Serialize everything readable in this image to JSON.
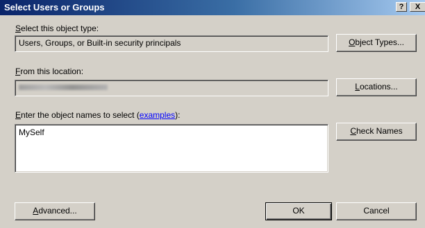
{
  "window": {
    "title": "Select Users or Groups",
    "help_glyph": "?",
    "close_glyph": "X"
  },
  "object_type": {
    "label_key": "S",
    "label_rest": "elect this object type:",
    "value": "Users, Groups, or Built-in security principals",
    "button_key": "O",
    "button_rest": "bject Types..."
  },
  "location": {
    "label_key": "F",
    "label_rest": "rom this location:",
    "value_obscured": true,
    "button_key": "L",
    "button_rest": "ocations..."
  },
  "names": {
    "label_key": "E",
    "label_pre": "nter the object names to select (",
    "label_link": "examples",
    "label_post": "):",
    "value": "MySelf",
    "button_key": "C",
    "button_rest": "heck Names"
  },
  "footer": {
    "advanced_key": "A",
    "advanced_rest": "dvanced...",
    "ok_label": "OK",
    "cancel_label": "Cancel"
  },
  "colors": {
    "dialog_face": "#d4d0c8",
    "title_start": "#0a246a",
    "title_end": "#a6caf0",
    "link": "#0000ff"
  }
}
